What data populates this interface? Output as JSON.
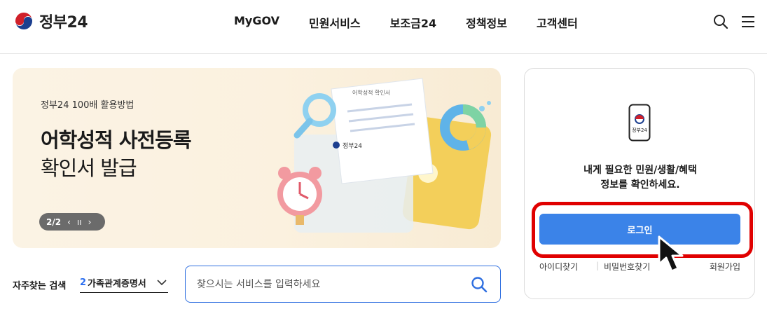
{
  "header": {
    "logo_text": "정부24",
    "nav": [
      "MyGOV",
      "민원서비스",
      "보조금24",
      "정책정보",
      "고객센터"
    ],
    "icons": [
      "search-icon",
      "menu-icon"
    ]
  },
  "banner": {
    "kicker": "정부24 100배 활용방법",
    "title_line1": "어학성적 사전등록",
    "title_line2": "확인서 발급",
    "pager": {
      "count": "2/2",
      "prev": "‹",
      "pause": "ıı",
      "next": "›"
    },
    "art_doc_label": "어학성적 확인서",
    "art_card_label": "정부24"
  },
  "search": {
    "frequent_label": "자주찾는 검색",
    "frequent_rank": "2",
    "frequent_value": "가족관계증명서",
    "placeholder": "찾으시는 서비스를 입력하세요"
  },
  "login_panel": {
    "phone_label": "정부24",
    "message_line1": "내게 필요한 민원/생활/혜택",
    "message_line2": "정보를 확인하세요.",
    "login_button": "로그인",
    "links": {
      "find_id": "아이디찾기",
      "separator": "|",
      "find_password": "비밀번호찾기",
      "join": "회원가입"
    }
  },
  "colors": {
    "brand_blue": "#3b83e8",
    "highlight_red": "#e00000",
    "search_border": "#2f6fe0"
  }
}
